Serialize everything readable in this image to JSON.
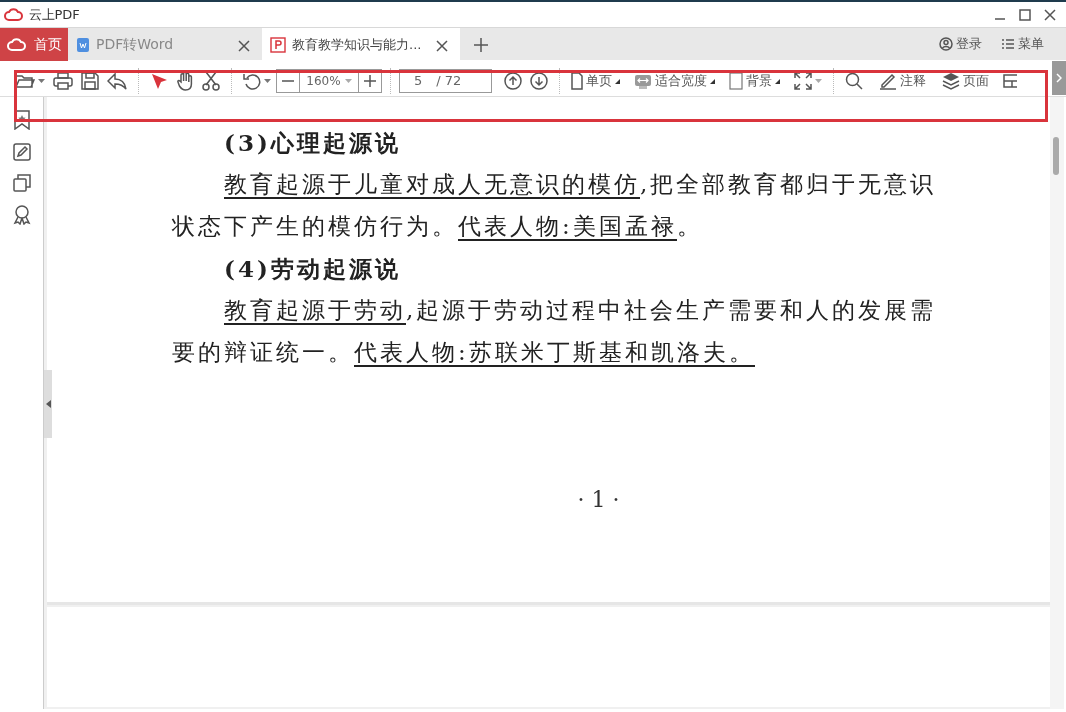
{
  "app": {
    "title": "云上PDF"
  },
  "tabs": [
    {
      "kind": "home",
      "label": "首页",
      "selected": false
    },
    {
      "kind": "word",
      "label": "PDF转Word",
      "selected": false
    },
    {
      "kind": "pdf",
      "label": "教育教学知识与能力...",
      "selected": true
    }
  ],
  "account": {
    "login": "登录",
    "menu": "菜单"
  },
  "toolbar": {
    "zoom": "160%",
    "page": "5",
    "page_total": "/ 72",
    "view_buttons": [
      "单页",
      "适合宽度",
      "背景"
    ],
    "tool_buttons": [
      "注释",
      "页面"
    ]
  },
  "document": {
    "blocks": [
      {
        "kind": "heading",
        "text": "(3)心理起源说"
      },
      {
        "kind": "paragraph",
        "segments": [
          {
            "text": "教育起源于儿童对成人无意识的模仿",
            "underlined": true
          },
          {
            "text": ",把全部教育都归于无意识状态下产生的模仿行为。",
            "underlined": false
          },
          {
            "text": "代表人物:美国孟禄",
            "underlined": true
          },
          {
            "text": "。",
            "underlined": false
          }
        ]
      },
      {
        "kind": "heading",
        "text": "(4)劳动起源说"
      },
      {
        "kind": "paragraph",
        "segments": [
          {
            "text": "教育起源于劳动",
            "underlined": true
          },
          {
            "text": ",起源于劳动过程中社会生产需要和人的发展需要的辩证统一。",
            "underlined": false
          },
          {
            "text": "代表人物:苏联米丁斯基和凯洛夫。",
            "underlined": true
          }
        ]
      }
    ],
    "page_number": "· 1 ·"
  }
}
